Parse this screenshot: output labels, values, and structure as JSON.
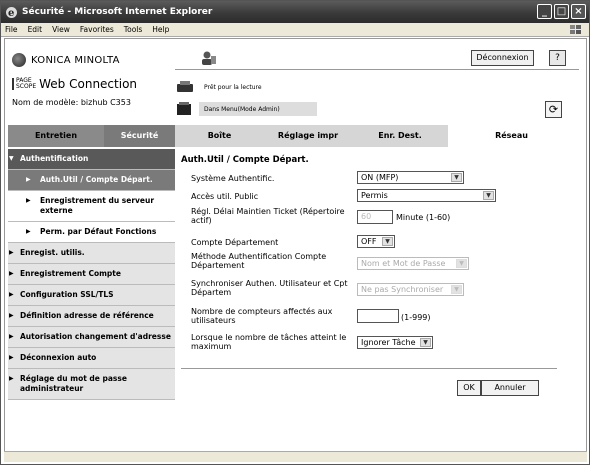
{
  "window": {
    "title": "Sécurité - Microsoft Internet Explorer"
  },
  "menu": [
    "File",
    "Edit",
    "View",
    "Favorites",
    "Tools",
    "Help"
  ],
  "brand": {
    "company": "KONICA MINOLTA",
    "product": "Web Connection",
    "pagescope": "PAGE\nSCOPE",
    "model": "Nom de modèle: bizhub C353"
  },
  "header": {
    "logout": "Déconnexion",
    "help": "?",
    "status1": "Prêt pour la lecture",
    "status2": "Dans Menu(Mode Admin)"
  },
  "tabs": [
    "Entretien",
    "Sécurité",
    "Boîte",
    "Réglage impr",
    "Enr. Dest.",
    "Réseau"
  ],
  "sidebar": {
    "head": "Authentification",
    "subs": [
      "Auth.Util / Compte Départ.",
      "Enregistrement du serveur externe",
      "Perm. par Défaut Fonctions"
    ],
    "items": [
      "Enregist. utilis.",
      "Enregistrement Compte",
      "Configuration SSL/TLS",
      "Définition adresse de référence",
      "Autorisation changement d'adresse",
      "Déconnexion auto",
      "Réglage du mot de passe administrateur"
    ]
  },
  "main": {
    "title": "Auth.Util / Compte Départ.",
    "fields": [
      {
        "label": "Système Authentific.",
        "value": "ON (MFP)"
      },
      {
        "label": "Accès util. Public",
        "value": "Permis"
      },
      {
        "label": "Régl. Délai Maintien Ticket (Répertoire actif)",
        "value": "60",
        "suffix": "Minute (1-60)"
      },
      {
        "label": "Compte Département",
        "value": "OFF"
      },
      {
        "label": "Méthode Authentification Compte Département",
        "value": "Nom et Mot de Passe"
      },
      {
        "label": "Synchroniser Authen. Utilisateur et Cpt Départem",
        "value": "Ne pas Synchroniser"
      },
      {
        "label": "Nombre de compteurs affectés aux utilisateurs",
        "value": "",
        "suffix": "(1-999)"
      },
      {
        "label": "Lorsque le nombre de tâches atteint le maximum",
        "value": "Ignorer Tâche"
      }
    ],
    "ok": "OK",
    "cancel": "Annuler"
  }
}
